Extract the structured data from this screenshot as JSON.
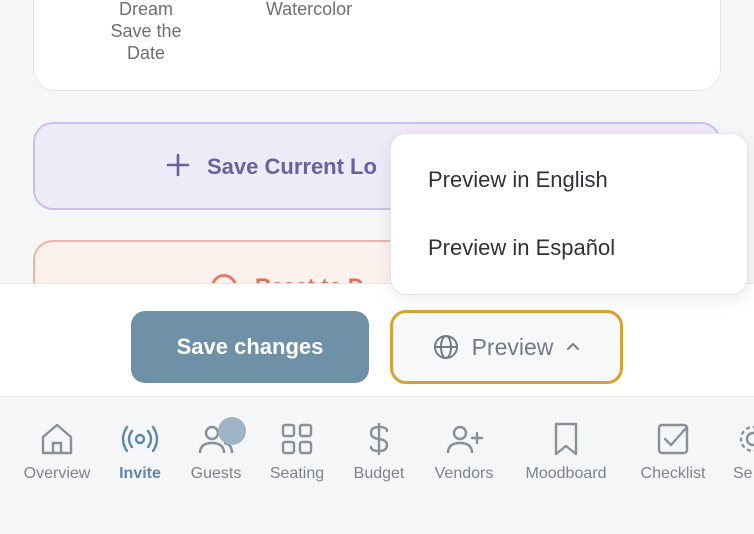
{
  "templates": {
    "item1_label": "Dream Save the Date",
    "item2_label": "Watercolor"
  },
  "save_look": {
    "label": "Save Current Lo"
  },
  "reset": {
    "label": "Reset to D"
  },
  "actions": {
    "save_label": "Save changes",
    "preview_label": "Preview"
  },
  "preview_menu": {
    "options": [
      "Preview in English",
      "Preview in Español"
    ]
  },
  "nav": {
    "items": [
      {
        "label": "Overview",
        "icon": "home-icon"
      },
      {
        "label": "Invite",
        "icon": "broadcast-icon",
        "active": true
      },
      {
        "label": "Guests",
        "icon": "users-icon"
      },
      {
        "label": "Seating",
        "icon": "grid-icon"
      },
      {
        "label": "Budget",
        "icon": "dollar-icon"
      },
      {
        "label": "Vendors",
        "icon": "user-plus-icon"
      },
      {
        "label": "Moodboard",
        "icon": "bookmark-icon"
      },
      {
        "label": "Checklist",
        "icon": "checkbox-icon"
      },
      {
        "label": "Se",
        "icon": "settings-icon"
      }
    ]
  },
  "colors": {
    "accent": "#5f88a4",
    "save_button": "#6f91a8",
    "preview_border": "#d9a132",
    "save_look_bg": "#efeaf8",
    "reset_bg": "#fdf1ee"
  }
}
